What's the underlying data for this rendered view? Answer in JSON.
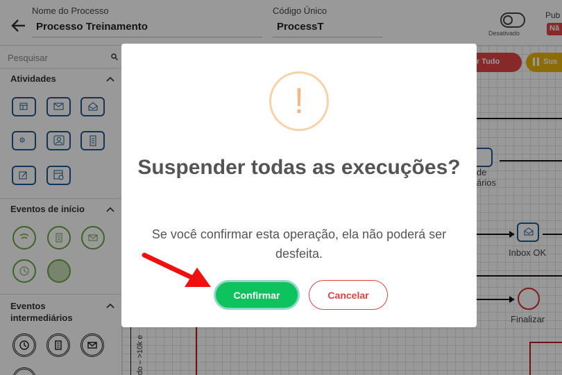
{
  "header": {
    "process_name_label": "Nome do Processo",
    "process_name_value": "Processo Treinamento",
    "code_label": "Código Único",
    "code_value": "ProcessT",
    "toggle_label": "Desativado",
    "publish_label": "Pub",
    "publish_badge": "Nã"
  },
  "sidebar": {
    "search_placeholder": "Pesquisar",
    "sections": {
      "activities": "Atividades",
      "start_events": "Eventos de início",
      "intermediate_events": "Eventos intermediários"
    }
  },
  "canvas": {
    "toolbar": {
      "red_button": "nar Tudo",
      "yellow_button": "Sus"
    },
    "nodes": {
      "task_label_line1": "a de",
      "task_label_line2": "atários",
      "inbox_label": "Inbox OK",
      "end_label": "Finalizar",
      "lane_label": "do – >10k e"
    }
  },
  "modal": {
    "icon_glyph": "!",
    "title": "Suspender todas as execuções?",
    "message": "Se você confirmar esta operação, ela não poderá ser desfeita.",
    "confirm_label": "Confirmar",
    "cancel_label": "Cancelar"
  },
  "colors": {
    "confirm": "#0ec25d",
    "cancel": "#d94444",
    "warning": "#f3b886",
    "activity_border": "#1d5b96",
    "start_event_border": "#68a642"
  }
}
